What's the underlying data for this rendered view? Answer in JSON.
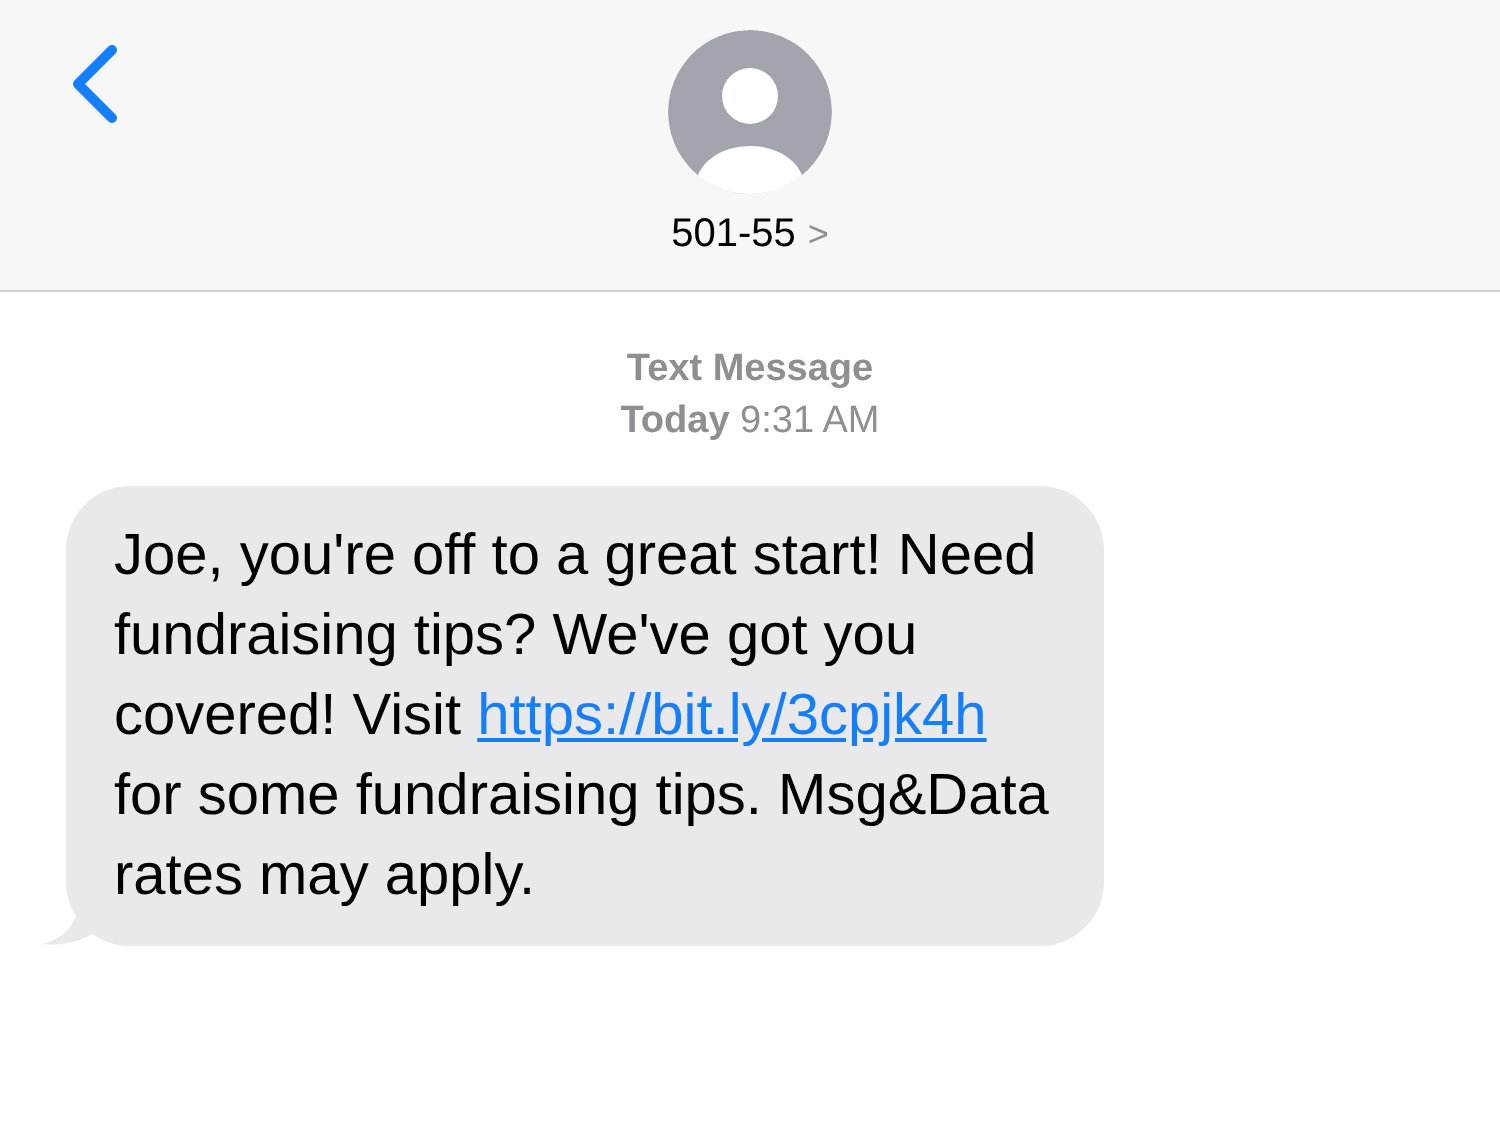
{
  "header": {
    "contact": "501-55",
    "chevron": ">"
  },
  "conversation": {
    "service": "Text Message",
    "day": "Today",
    "time": "9:31 AM"
  },
  "message": {
    "text_before": "Joe, you're off to a great start! Need fundraising tips? We've got you covered! Visit",
    "link": "https://bit.ly/3cpjk4h",
    "text_after": "for some fundraising tips. Msg&Data rates may apply."
  }
}
